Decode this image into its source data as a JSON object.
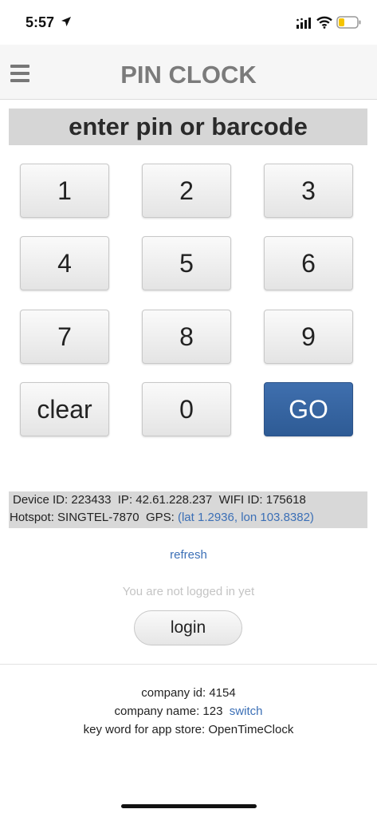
{
  "status_bar": {
    "time": "5:57"
  },
  "header": {
    "title": "PIN CLOCK"
  },
  "prompt": "enter pin or barcode",
  "keypad": {
    "keys": [
      "1",
      "2",
      "3",
      "4",
      "5",
      "6",
      "7",
      "8",
      "9",
      "clear",
      "0",
      "GO"
    ],
    "go_color": "#2e5b95"
  },
  "info": {
    "device_id_label": "Device ID:",
    "device_id": "223433",
    "ip_label": "IP:",
    "ip": "42.61.228.237",
    "wifi_label": "WIFI ID:",
    "wifi_id": "175618",
    "hotspot_label": "Hotspot:",
    "hotspot": "SINGTEL-7870",
    "gps_label": "GPS:",
    "gps": "(lat 1.2936, lon 103.8382)"
  },
  "refresh_label": "refresh",
  "login_status": "You are not logged in yet",
  "login_label": "login",
  "footer": {
    "company_id_label": "company id:",
    "company_id": "4154",
    "company_name_label": "company name:",
    "company_name": "123",
    "switch_label": "switch",
    "keyword_label": "key word for app store:",
    "keyword": "OpenTimeClock"
  },
  "icons": [
    "location-arrow-icon",
    "signal-icon",
    "wifi-icon",
    "battery-icon",
    "menu-icon"
  ],
  "colors": {
    "link": "#3b6fb6",
    "header_bg": "#f6f6f6",
    "battery_fill": "#f5c400"
  }
}
